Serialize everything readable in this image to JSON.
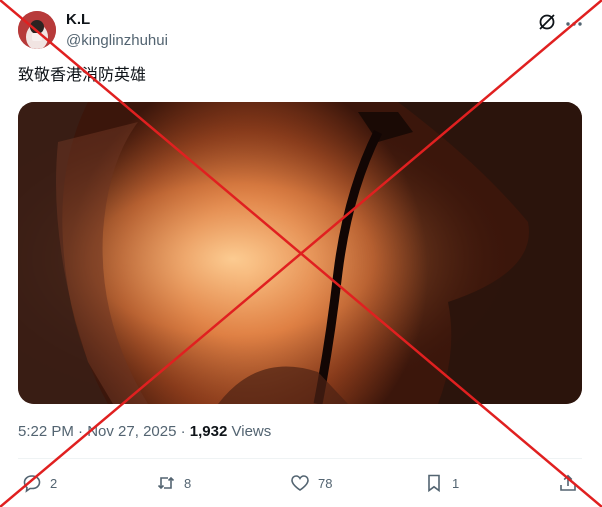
{
  "author": {
    "display_name": "K.L",
    "handle": "@kinglinzhuhui"
  },
  "post": {
    "text": "致敬香港消防英雄",
    "time": "5:22 PM",
    "date": "Nov 27, 2025",
    "views_count": "1,932",
    "views_label": "Views"
  },
  "actions": {
    "replies": "2",
    "reposts": "8",
    "likes": "78",
    "bookmarks": "1"
  },
  "icons": [
    "grok-icon",
    "more-icon",
    "reply-icon",
    "repost-icon",
    "like-icon",
    "bookmark-icon",
    "share-icon"
  ],
  "colors": {
    "text": "#0f1419",
    "secondary": "#536471",
    "divider": "#eff3f4",
    "overlay_cross": "#e02020"
  }
}
